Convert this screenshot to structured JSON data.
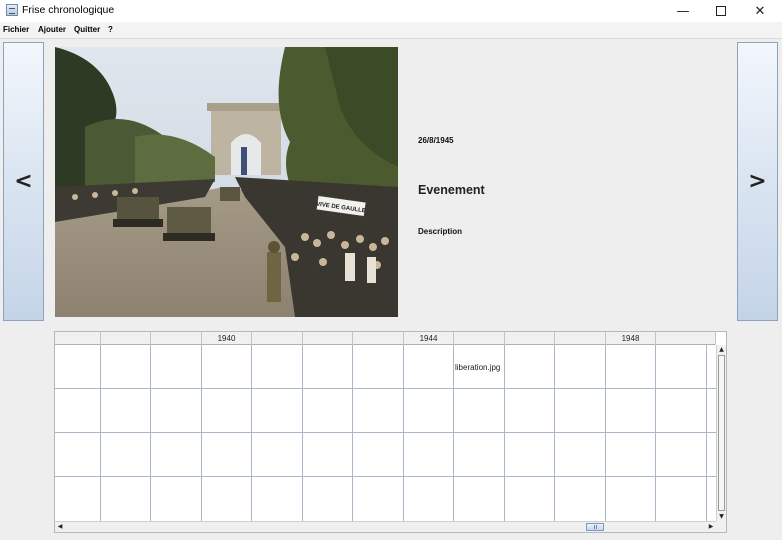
{
  "window": {
    "title": "Frise chronologique",
    "minimize_glyph": "—",
    "close_glyph": "✕"
  },
  "menu": {
    "items": [
      "Fichier",
      "Ajouter",
      "Quitter",
      "?"
    ]
  },
  "navigation": {
    "prev_label": "<",
    "next_label": ">"
  },
  "event": {
    "date": "26/8/1945",
    "title": "Evenement",
    "description": "Description",
    "photo_sign_text": "VIVE DE GAULLE"
  },
  "timeline": {
    "header_labels": [
      "",
      "",
      "",
      "1940",
      "",
      "",
      "",
      "1944",
      "",
      "",
      "",
      "1948",
      ""
    ],
    "cell_entries": [
      {
        "row": 0,
        "col": 8,
        "text": "liberation.jpg"
      }
    ],
    "row_count": 4
  },
  "icons": {
    "app": "app-window-icon",
    "minimize": "minimize-icon",
    "maximize": "maximize-icon",
    "close": "close-icon",
    "prev": "chevron-left-icon",
    "next": "chevron-right-icon"
  }
}
